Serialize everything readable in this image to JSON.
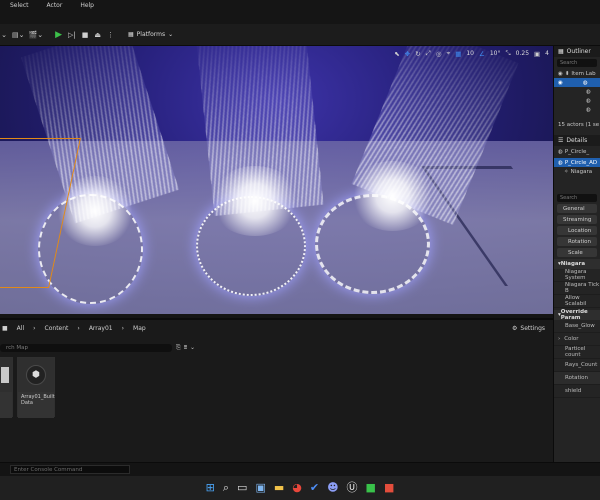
{
  "menu": {
    "items": [
      "Select",
      "Actor",
      "Help"
    ]
  },
  "toolbar": {
    "platforms_label": "Platforms"
  },
  "viewport": {
    "grid_snap": "10",
    "rotation_snap": "10°",
    "scale_snap": "0.25",
    "camera_speed": "4"
  },
  "outliner": {
    "tab": "Outliner",
    "search_placeholder": "Search",
    "column_header": "Item Lab",
    "actor_count": "15 actors (1 se"
  },
  "details": {
    "tab": "Details",
    "actor_name": "P_Circle_",
    "component": "P_Circle_AD",
    "sub_component": "Niagara",
    "search_placeholder": "Search",
    "filters": [
      "General",
      "Streaming"
    ],
    "transform": [
      "Location",
      "Rotation",
      "Scale"
    ],
    "section_niagara": "Niagara",
    "niagara_props": [
      "Niagara System",
      "Niagara Tick B",
      "Allow Scalabil"
    ],
    "section_override": "Override Param",
    "override_props": [
      "Base_Glow",
      "Color",
      "Particel count",
      "Rays_Count",
      "Rotation",
      "shield"
    ]
  },
  "content_browser": {
    "breadcrumb": [
      "All",
      "Content",
      "Array01",
      "Map"
    ],
    "settings_label": "Settings",
    "search_placeholder": "rch Map",
    "assets": [
      {
        "name": ""
      },
      {
        "name": "Array01_Built Data"
      }
    ]
  },
  "console": {
    "placeholder": "Enter Console Command"
  },
  "taskbar": {
    "apps": [
      "windows-icon",
      "search-icon",
      "task-view-icon",
      "widgets-icon",
      "file-explorer-icon",
      "chrome-icon",
      "todo-icon",
      "discord-icon",
      "unreal-icon",
      "camtasia-icon",
      "app-icon"
    ]
  },
  "colors": {
    "accent": "#1f5fae",
    "selection": "#e28a18",
    "play": "#3cc04a"
  }
}
